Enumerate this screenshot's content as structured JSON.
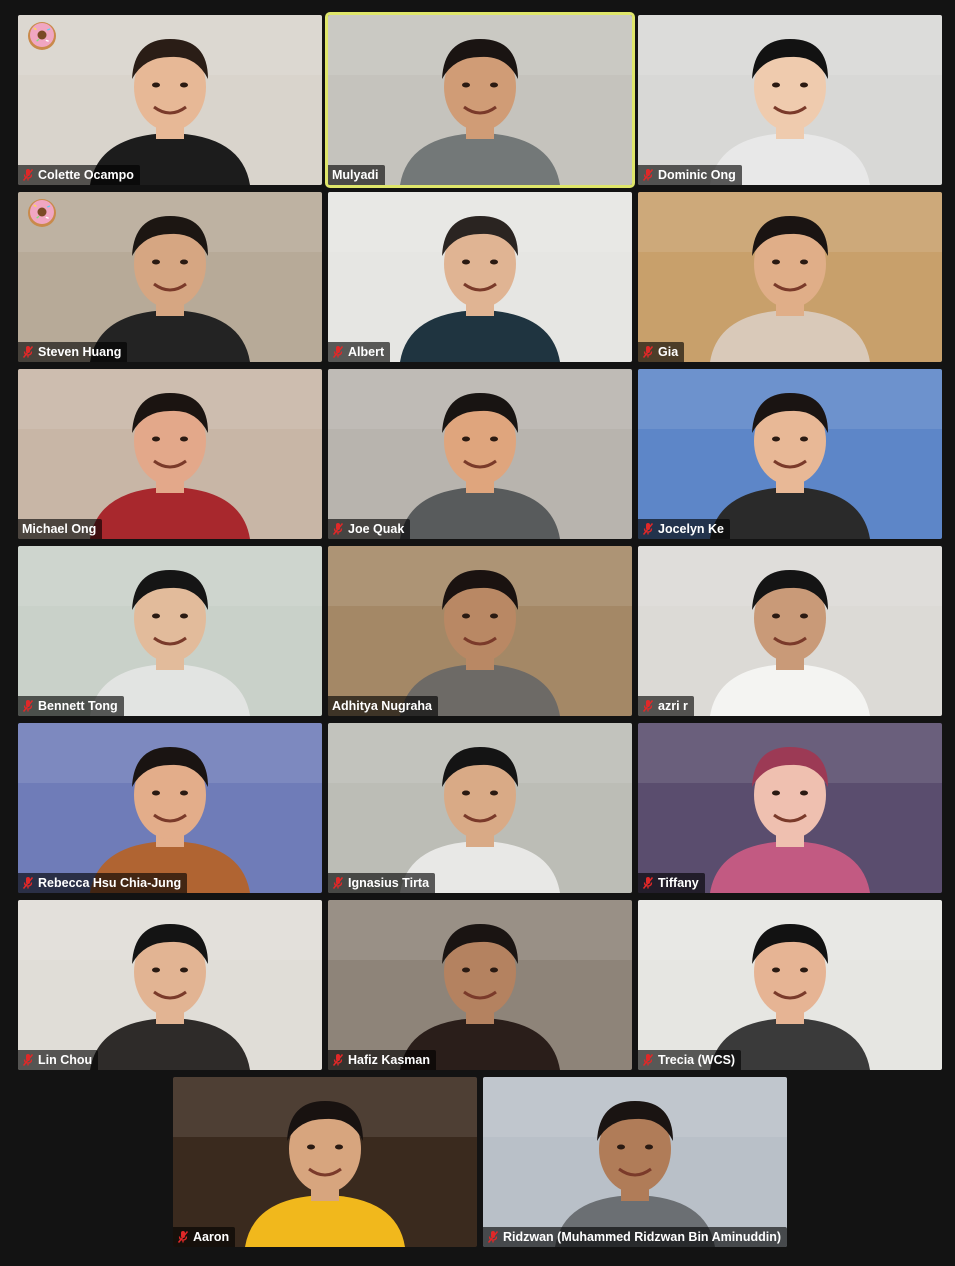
{
  "meeting": {
    "participants": [
      {
        "name": "Colette Ocampo",
        "muted": true,
        "reaction": "donut",
        "bg": "#d9d4cc",
        "skin": "#e7b896",
        "hair": "#2a1d16",
        "shirt": "#1c1c1c"
      },
      {
        "name": "Mulyadi",
        "muted": false,
        "active": true,
        "bg": "#c5c3bd",
        "skin": "#d09c76",
        "hair": "#1a1412",
        "shirt": "#737878"
      },
      {
        "name": "Dominic Ong",
        "muted": true,
        "bg": "#d8d8d6",
        "skin": "#efcbae",
        "hair": "#121212",
        "shirt": "#e8e8e8"
      },
      {
        "name": "Steven Huang",
        "muted": true,
        "reaction": "donut",
        "bg": "#b7aa98",
        "skin": "#d6a682",
        "hair": "#1c1612",
        "shirt": "#232323"
      },
      {
        "name": "Albert",
        "muted": true,
        "bg": "#e6e6e3",
        "skin": "#e0b493",
        "hair": "#2a2421",
        "shirt": "#1f3440"
      },
      {
        "name": "Gia",
        "muted": true,
        "bg": "#c8a06b",
        "skin": "#e0ae88",
        "hair": "#1a1412",
        "shirt": "#d9c9b9"
      },
      {
        "name": "Michael Ong",
        "muted": false,
        "bg": "#c8b6a6",
        "skin": "#e3a88a",
        "hair": "#1b1411",
        "shirt": "#a8282d"
      },
      {
        "name": "Joe Quak",
        "muted": true,
        "bg": "#b8b4ae",
        "skin": "#dfa57d",
        "hair": "#181412",
        "shirt": "#585b5c"
      },
      {
        "name": "Jocelyn Ke",
        "muted": true,
        "bg": "#5d86c8",
        "skin": "#e8b896",
        "hair": "#1a1412",
        "shirt": "#2a2a2a"
      },
      {
        "name": "Bennett Tong",
        "muted": true,
        "bg": "#c9d1c9",
        "skin": "#e2bb9b",
        "hair": "#151515",
        "shirt": "#e2e4e2"
      },
      {
        "name": "Adhitya Nugraha",
        "muted": false,
        "bg": "#a48866",
        "skin": "#b98864",
        "hair": "#1a1210",
        "shirt": "#6d6a66"
      },
      {
        "name": "azri r",
        "muted": true,
        "bg": "#dcdad6",
        "skin": "#c99a78",
        "hair": "#141414",
        "shirt": "#f4f4f2"
      },
      {
        "name": "Rebecca Hsu Chia-Jung",
        "muted": true,
        "bg": "#6f7cb8",
        "skin": "#e3ad8a",
        "hair": "#1a1412",
        "shirt": "#b06432"
      },
      {
        "name": "Ignasius Tirta",
        "muted": true,
        "bg": "#bcbdb6",
        "skin": "#d9aa86",
        "hair": "#141414",
        "shirt": "#e8e8e6"
      },
      {
        "name": "Tiffany",
        "muted": true,
        "bg": "#5a4d6e",
        "skin": "#efc0b0",
        "hair": "#9c3a55",
        "shirt": "#c25a82"
      },
      {
        "name": "Lin Chou",
        "muted": true,
        "bg": "#e0ddd7",
        "skin": "#e2b493",
        "hair": "#141414",
        "shirt": "#2e2b29"
      },
      {
        "name": "Hafiz Kasman",
        "muted": true,
        "bg": "#8e8479",
        "skin": "#b48260",
        "hair": "#1a1412",
        "shirt": "#2a1e1a"
      },
      {
        "name": "Trecia (WCS)",
        "muted": true,
        "bg": "#e6e6e2",
        "skin": "#e6b494",
        "hair": "#121212",
        "shirt": "#3a3a3a"
      },
      {
        "name": "Aaron",
        "muted": true,
        "bg": "#3a2a1e",
        "skin": "#d7a57e",
        "hair": "#181210",
        "shirt": "#f1b81c"
      },
      {
        "name": "Ridzwan (Muhammed Ridzwan Bin Aminuddin)",
        "muted": true,
        "bg": "#b9c0c8",
        "skin": "#b07c58",
        "hair": "#1a1412",
        "shirt": "#6b6f73"
      }
    ],
    "icons": {
      "muted": "mic-muted-icon",
      "reaction": "donut-icon"
    },
    "colors": {
      "background": "#131313",
      "active_border": "#dfe66a",
      "nameplate": "#000000",
      "muted_icon": "#e02828"
    }
  }
}
